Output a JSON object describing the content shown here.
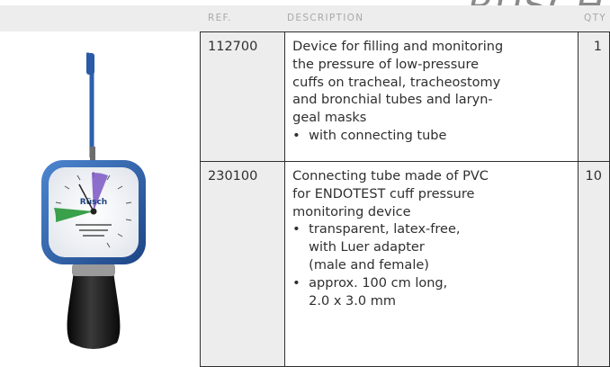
{
  "brand": "RÜSCH",
  "headers": {
    "ref": "REF.",
    "description": "DESCRIPTION",
    "qty": "QTY"
  },
  "rows": [
    {
      "ref": "112700",
      "desc_lines": [
        "Device for filling and monitoring",
        "the pressure of low-pressure",
        "cuffs on tracheal, tracheostomy",
        "and bronchial tubes and laryn-",
        "geal masks"
      ],
      "bullets": [
        [
          "with connecting tube"
        ]
      ],
      "qty": "1"
    },
    {
      "ref": "230100",
      "desc_lines": [
        "Connecting tube made of PVC",
        "for ENDOTEST cuff pressure",
        "monitoring device"
      ],
      "bullets": [
        [
          "transparent, latex-free,",
          "with Luer adapter",
          "(male and female)"
        ],
        [
          "approx. 100 cm long,",
          "2.0 x 3.0 mm"
        ]
      ],
      "qty": "10"
    }
  ],
  "gauge_brand": "Rüsch",
  "colors": {
    "header_bg": "#ededed",
    "gauge_rim": "#2c5fa8",
    "handle": "#1a1a1a",
    "zone_green": "#3aa04a",
    "zone_violet": "#7a56c4"
  }
}
